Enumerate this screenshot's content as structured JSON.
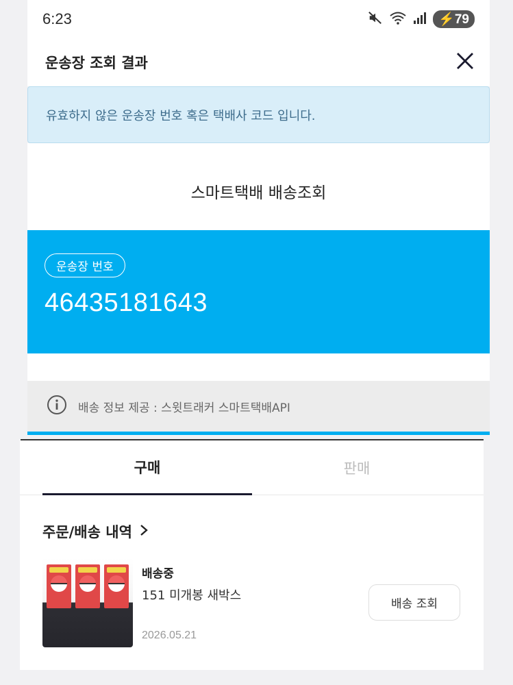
{
  "status_bar": {
    "time": "6:23",
    "battery": "79",
    "icons": [
      "mute-icon",
      "wifi-icon",
      "signal-icon",
      "battery-icon"
    ]
  },
  "modal": {
    "title": "운송장 조회 결과",
    "close_icon": "close-icon"
  },
  "error_banner": {
    "text": "유효하지 않은 운송장 번호 혹은 택배사 코드 입니다."
  },
  "service": {
    "title": "스마트택배 배송조회"
  },
  "tracking": {
    "label": "운송장 번호",
    "number": "46435181643"
  },
  "provider": {
    "icon": "info-icon",
    "text": "배송 정보 제공 : 스윗트래커 스마트택배API"
  },
  "tabs": [
    {
      "label": "구매",
      "active": true
    },
    {
      "label": "판매",
      "active": false
    }
  ],
  "orders": {
    "section_title": "주문/배송 내역",
    "items": [
      {
        "status": "배송중",
        "name": "151 미개봉 새박스",
        "date": "2026.05.21",
        "button_label": "배송 조회"
      }
    ]
  },
  "colors": {
    "accent": "#00aef0",
    "banner_bg": "#d9eef9",
    "banner_text": "#3d6c8c"
  }
}
